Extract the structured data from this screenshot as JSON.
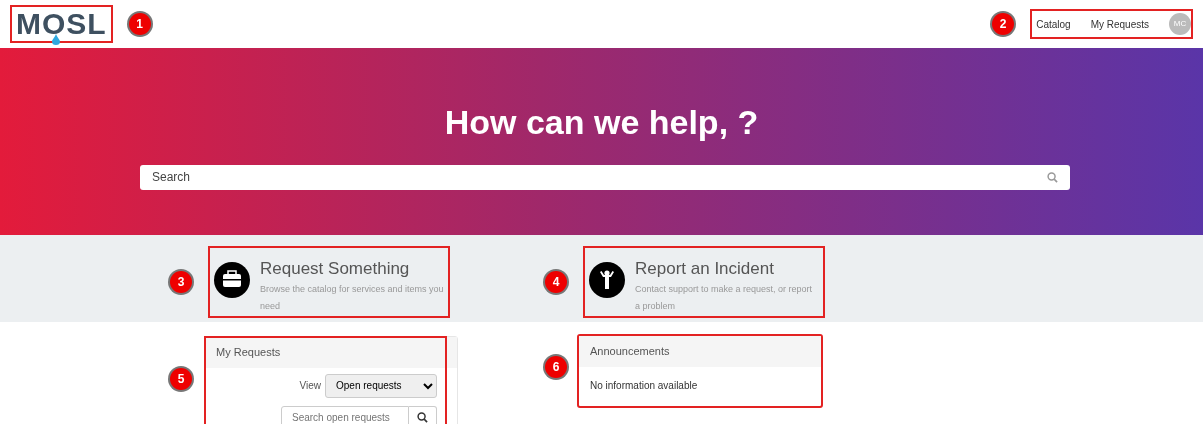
{
  "header": {
    "logo": "MOSL",
    "logo_callout": "1",
    "nav": [
      {
        "label": "Catalog"
      },
      {
        "label": "My Requests"
      }
    ],
    "nav_callout": "2",
    "avatar": "MC"
  },
  "hero": {
    "title": "How can we help, ?",
    "search_placeholder": "Search"
  },
  "tiles": [
    {
      "kind": "briefcase",
      "title": "Request Something",
      "description": "Browse the catalog for services and items you need",
      "callout": "3"
    },
    {
      "kind": "person",
      "title": "Report an Incident",
      "description": "Contact support to make a request, or report a problem",
      "callout": "4"
    }
  ],
  "my_requests": {
    "title": "My Requests",
    "view_label": "View",
    "view_value": "Open requests",
    "search_placeholder": "Search open requests",
    "callout": "5"
  },
  "announcements": {
    "title": "Announcements",
    "message": "No information available",
    "callout": "6"
  }
}
